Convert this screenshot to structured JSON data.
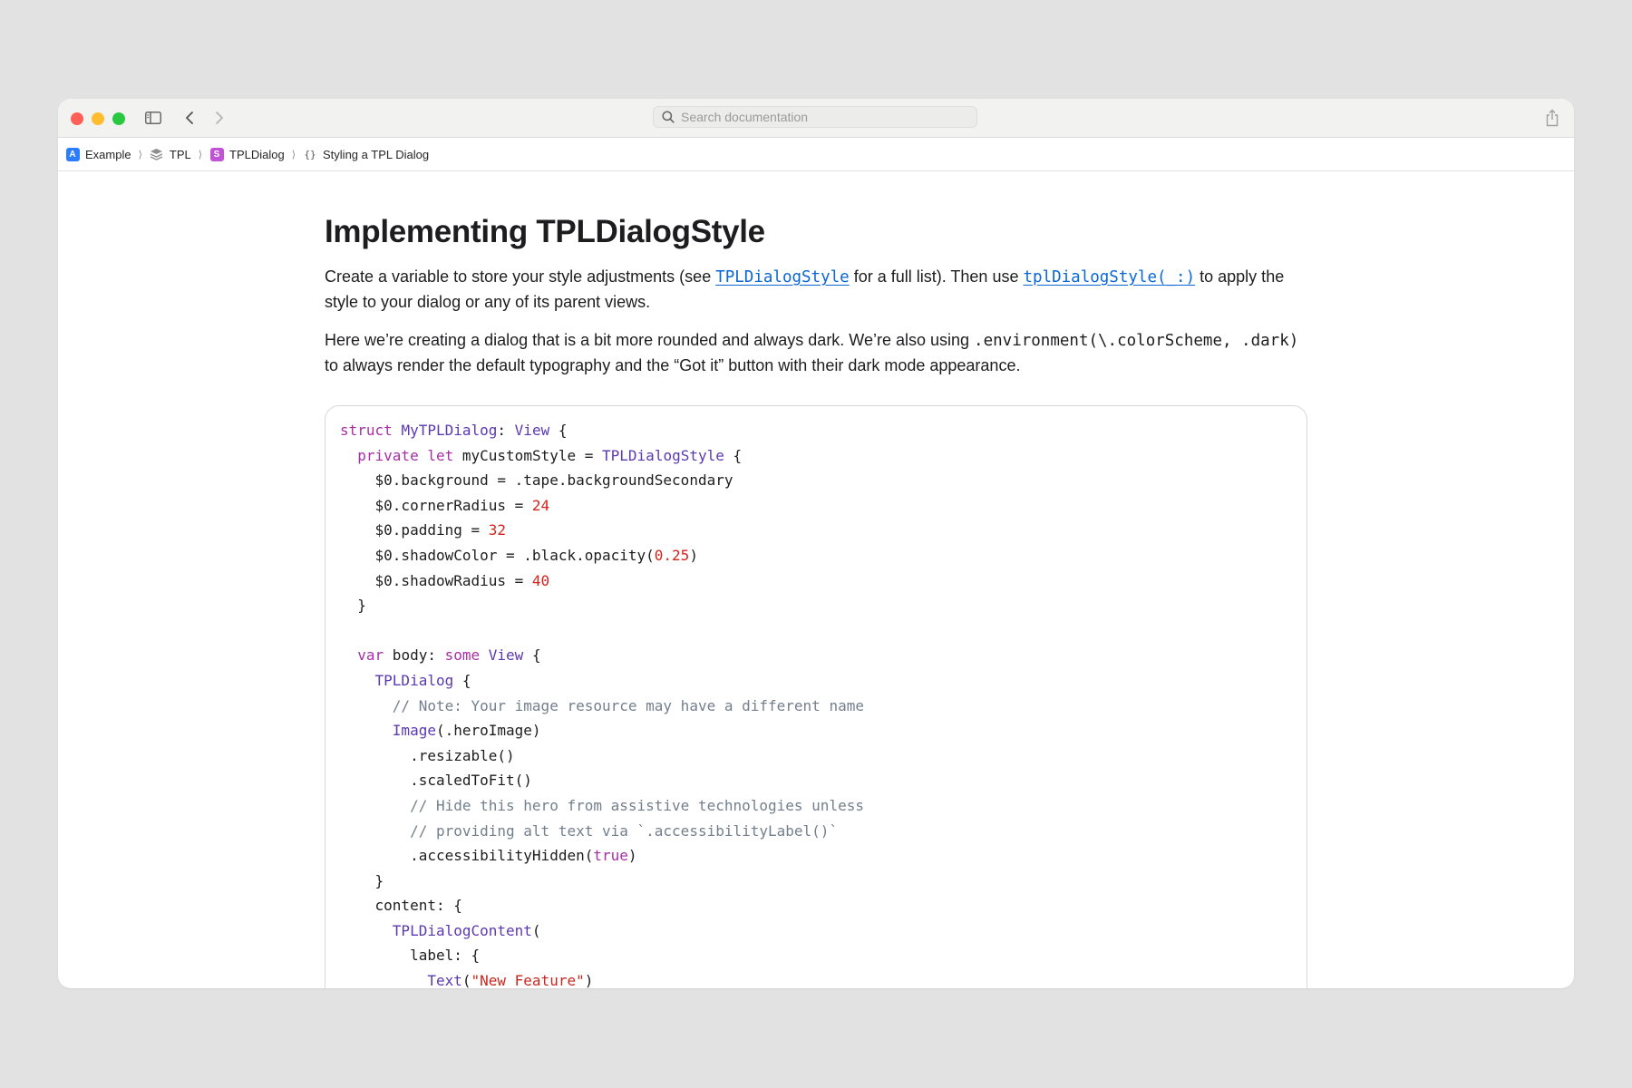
{
  "window": {
    "search_placeholder": "Search documentation",
    "icons": {
      "sidebar_toggle": "sidebar-toggle-icon",
      "back": "chevron-left-icon",
      "forward": "chevron-right-icon",
      "share": "share-icon",
      "search": "search-icon"
    },
    "traffic_lights": {
      "close": "#fe5f57",
      "minimize": "#febc2e",
      "zoom": "#28c840"
    }
  },
  "breadcrumbs": [
    {
      "label": "Example",
      "icon": "app-icon"
    },
    {
      "label": "TPL",
      "icon": "framework-stack-icon"
    },
    {
      "label": "TPLDialog",
      "icon": "swift-struct-icon"
    },
    {
      "label": "Styling a TPL Dialog",
      "icon": "article-braces-icon"
    }
  ],
  "article": {
    "title": "Implementing TPLDialogStyle",
    "para1": {
      "t1": "Create a variable to store your style adjustments (see ",
      "link1": "TPLDialogStyle",
      "t2": " for a full list). Then use ",
      "link2": "tplDialogStyle(_:)",
      "t3": " to apply the style to your dialog or any of its parent views."
    },
    "para2": {
      "t1": "Here we’re creating a dialog that is a bit more rounded and always dark. We’re also using ",
      "code": ".environment(\\.colorScheme, .dark)",
      "t2": " to always render the default typography and the “Got it” button with their dark mode appearance."
    }
  },
  "code": {
    "lines": [
      [
        [
          "kw",
          "struct"
        ],
        [
          "pl",
          " "
        ],
        [
          "ty",
          "MyTPLDialog"
        ],
        [
          "pl",
          ": "
        ],
        [
          "ty",
          "View"
        ],
        [
          "pl",
          " {"
        ]
      ],
      [
        [
          "pl",
          "  "
        ],
        [
          "kw",
          "private"
        ],
        [
          "pl",
          " "
        ],
        [
          "kw",
          "let"
        ],
        [
          "pl",
          " myCustomStyle = "
        ],
        [
          "ty",
          "TPLDialogStyle"
        ],
        [
          "pl",
          " {"
        ]
      ],
      [
        [
          "pl",
          "    $0.background = .tape.backgroundSecondary"
        ]
      ],
      [
        [
          "pl",
          "    $0.cornerRadius = "
        ],
        [
          "num",
          "24"
        ]
      ],
      [
        [
          "pl",
          "    $0.padding = "
        ],
        [
          "num",
          "32"
        ]
      ],
      [
        [
          "pl",
          "    $0.shadowColor = .black.opacity("
        ],
        [
          "num",
          "0.25"
        ],
        [
          "pl",
          ")"
        ]
      ],
      [
        [
          "pl",
          "    $0.shadowRadius = "
        ],
        [
          "num",
          "40"
        ]
      ],
      [
        [
          "pl",
          "  }"
        ]
      ],
      [
        [
          "pl",
          ""
        ]
      ],
      [
        [
          "pl",
          "  "
        ],
        [
          "kw",
          "var"
        ],
        [
          "pl",
          " body: "
        ],
        [
          "kw",
          "some"
        ],
        [
          "pl",
          " "
        ],
        [
          "ty",
          "View"
        ],
        [
          "pl",
          " {"
        ]
      ],
      [
        [
          "pl",
          "    "
        ],
        [
          "ty",
          "TPLDialog"
        ],
        [
          "pl",
          " {"
        ]
      ],
      [
        [
          "cm",
          "      // Note: Your image resource may have a different name"
        ]
      ],
      [
        [
          "pl",
          "      "
        ],
        [
          "ty",
          "Image"
        ],
        [
          "pl",
          "(.heroImage)"
        ]
      ],
      [
        [
          "pl",
          "        .resizable()"
        ]
      ],
      [
        [
          "pl",
          "        .scaledToFit()"
        ]
      ],
      [
        [
          "cm",
          "        // Hide this hero from assistive technologies unless"
        ]
      ],
      [
        [
          "cm",
          "        // providing alt text via `.accessibilityLabel()`"
        ]
      ],
      [
        [
          "pl",
          "        .accessibilityHidden("
        ],
        [
          "kw",
          "true"
        ],
        [
          "pl",
          ")"
        ]
      ],
      [
        [
          "pl",
          "    }"
        ]
      ],
      [
        [
          "pl",
          "    content: {"
        ]
      ],
      [
        [
          "pl",
          "      "
        ],
        [
          "ty",
          "TPLDialogContent"
        ],
        [
          "pl",
          "("
        ]
      ],
      [
        [
          "pl",
          "        label: {"
        ]
      ],
      [
        [
          "pl",
          "          "
        ],
        [
          "ty",
          "Text"
        ],
        [
          "pl",
          "("
        ],
        [
          "str",
          "\"New Feature\""
        ],
        [
          "pl",
          ")"
        ]
      ]
    ]
  },
  "colors": {
    "keyword": "#a62fa5",
    "type": "#5b39b0",
    "number": "#d3231f",
    "string": "#c7281f",
    "comment": "#737f8c",
    "link": "#0a66d6"
  }
}
